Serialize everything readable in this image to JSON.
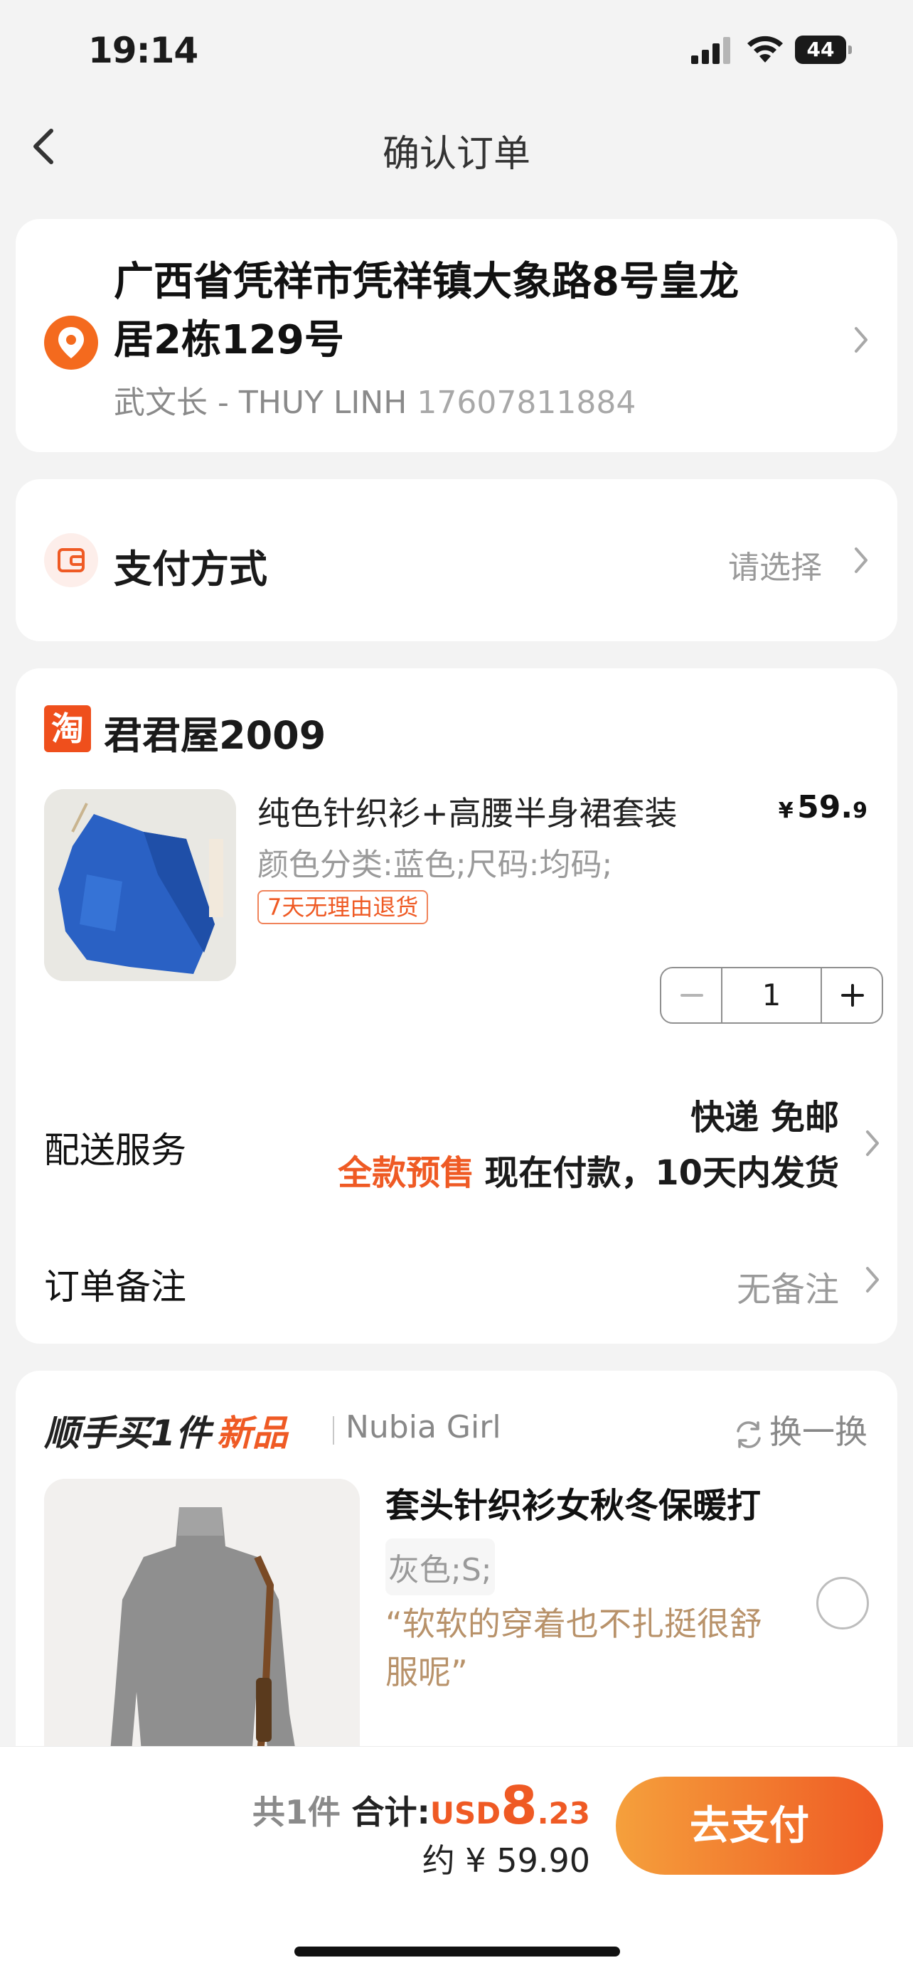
{
  "status_bar": {
    "time": "19:14",
    "battery": "44"
  },
  "nav": {
    "title": "确认订单"
  },
  "address": {
    "line1": "广西省凭祥市凭祥镇大象路8号皇龙",
    "line2": "居2栋129号",
    "recipient": "武文长 - THUY LINH",
    "phone": "17607811884"
  },
  "payment": {
    "label": "支付方式",
    "value": "请选择"
  },
  "shop": {
    "logo": "淘",
    "name": "君君屋2009",
    "product": {
      "title": "纯色针织衫+高腰半身裙套装",
      "spec": "颜色分类:蓝色;尺码:均码;",
      "badge": "7天无理由退货",
      "price_symbol": "¥",
      "price_int": "59.",
      "price_dec": "9",
      "quantity": "1"
    },
    "delivery": {
      "label": "配送服务",
      "line1": "快递 免邮",
      "presale": "全款预售",
      "ship_text": "现在付款，10天内发货"
    },
    "note": {
      "label": "订单备注",
      "value": "无备注"
    }
  },
  "recommend": {
    "title": "顺手买1件",
    "new_tag": "新品",
    "brand": "Nubia Girl",
    "refresh": "换一换",
    "product": {
      "title": "套头针织衫女秋冬保暖打",
      "spec": "灰色;S;",
      "quote": "“软软的穿着也不扎挺很舒服呢”"
    }
  },
  "bottom": {
    "count": "共1件",
    "total_label": "合计:",
    "currency": "USD",
    "total_int": "8",
    "total_dec": ".23",
    "approx": "约 ¥ 59.90",
    "pay_button": "去支付"
  },
  "colors": {
    "accent": "#ef5a24",
    "accent_light": "#f5a03c",
    "quote": "#b8926a"
  }
}
